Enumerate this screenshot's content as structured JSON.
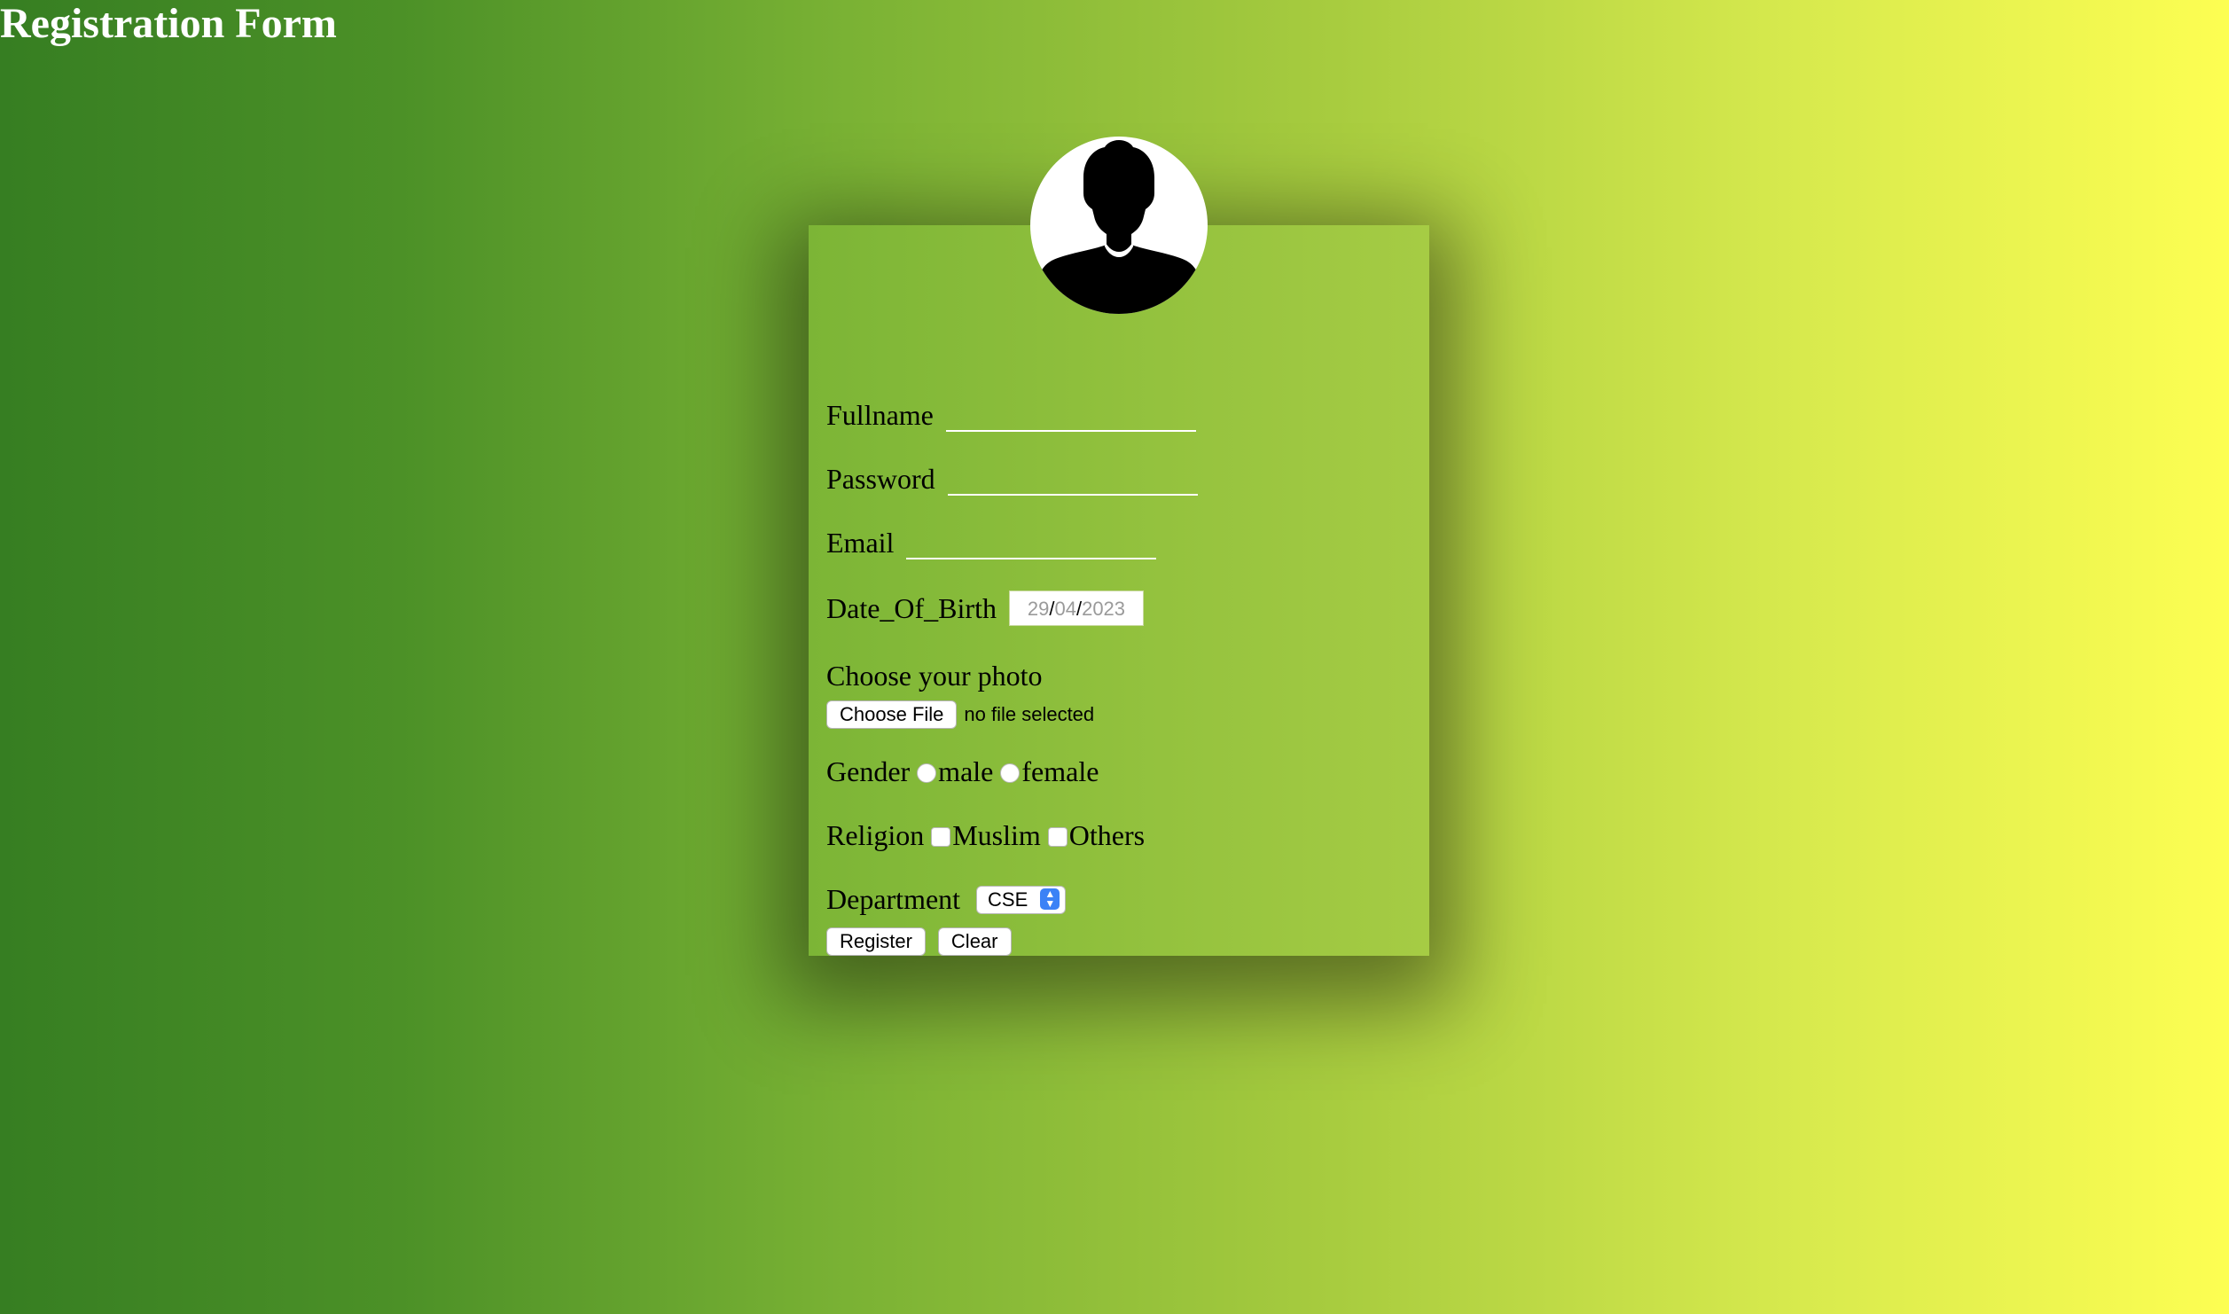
{
  "page": {
    "title": "Registration Form"
  },
  "avatar": {
    "icon": "user-silhouette-icon"
  },
  "form": {
    "fullname_label": "Fullname",
    "fullname_value": "",
    "password_label": "Password",
    "password_value": "",
    "email_label": "Email",
    "email_value": "",
    "dob_label": "Date_Of_Birth",
    "dob_day": "29",
    "dob_month": "04",
    "dob_year": "2023",
    "dob_sep": "/",
    "photo_label": "Choose your photo",
    "choose_file_label": "Choose File",
    "file_status": "no file selected",
    "gender_label": "Gender",
    "gender_options": [
      "male",
      "female"
    ],
    "religion_label": "Religion",
    "religion_options": [
      "Muslim",
      "Others"
    ],
    "department_label": "Department",
    "department_selected": "CSE",
    "register_label": "Register",
    "clear_label": "Clear"
  },
  "colors": {
    "gradient_start": "#367e22",
    "gradient_end": "#fdfe52",
    "card_start": "#7cb536",
    "card_end": "#a6cc44",
    "select_accent": "#3b82f6"
  }
}
